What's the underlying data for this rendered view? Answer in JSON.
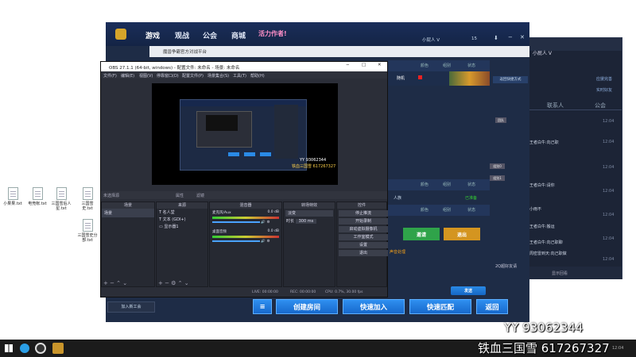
{
  "desktop": {
    "icons": [
      {
        "label": "小果果.txt"
      },
      {
        "label": "电竞帐.txt"
      },
      {
        "label": "三国雪后人星.txt"
      },
      {
        "label": "三国雪史.txt"
      },
      {
        "label": "三国雪史分部.txt"
      }
    ]
  },
  "client": {
    "nav": [
      "游戏",
      "观战",
      "公会",
      "商城"
    ],
    "banner": "活力作者!",
    "user": "小屁人 V",
    "coins": "15",
    "subwindow_title": "魔兽争霸官方对战平台",
    "table_headers": [
      "颜色",
      "组别",
      "状态"
    ],
    "row_name": "随机",
    "side_buttons": [
      "返回快捷方式",
      "团队"
    ],
    "mid_badges": [
      "组别0",
      "组别1"
    ],
    "player_label": "人族",
    "ready_label": "已准备",
    "btn_invite": "邀请",
    "btn_exit": "退出",
    "link_text": "声音处理",
    "add_friend": "加入新工会",
    "footer_hint": "2Q超好友请",
    "send_btn": "发送",
    "bottom_buttons": [
      "创建房间",
      "快速加入",
      "快速匹配",
      "返回"
    ]
  },
  "friends": {
    "title": "小屁人 V",
    "tabs": [
      "联系人",
      "公会"
    ],
    "rows": [
      "王者白牛:向己职",
      "王者白牛:请你",
      "小雨不",
      "王者白牛:搬运",
      "王者白牛:向己职聊",
      "周密雷到天:向己职做"
    ],
    "times": [
      "12:04",
      "12:04",
      "12:04",
      "12:04",
      "12:04",
      "12:04",
      "12:04"
    ],
    "footer": "显示回看",
    "side": [
      "应援完善",
      "实时好友"
    ]
  },
  "obs": {
    "title": "OBS 27.1.1 (64-bit, windows) - 配置文件: 未命名 - 场景: 未命名",
    "menu": [
      "文件(F)",
      "编辑(E)",
      "视图(V)",
      "停靠窗口(D)",
      "配置文件(P)",
      "场景集合(S)",
      "工具(T)",
      "帮助(H)"
    ],
    "source_bar": "未选择源",
    "props_btn": "属性",
    "filter_btn": "滤镜",
    "docks": {
      "scenes": "场景",
      "sources": "来源",
      "mixer": "混音器",
      "transitions": "转场特效",
      "controls": "控件"
    },
    "scene_item": "场景",
    "sources": [
      "名人堂",
      "文本 (GDI+)",
      "显示器1"
    ],
    "mixer_items": [
      {
        "name": "麦克风/Aux",
        "db": "0.0 dB"
      },
      {
        "name": "桌面音频",
        "db": "0.0 dB"
      }
    ],
    "transition": "淡变",
    "duration_label": "时长",
    "duration_value": "300 ms",
    "controls": [
      "停止推流",
      "开始录制",
      "启动虚拟摄像机",
      "工作室模式",
      "设置",
      "退出"
    ],
    "status": {
      "live": "LIVE: 00:00:00",
      "rec": "REC: 00:00:00",
      "cpu": "CPU: 0.7%, 30.00 fps"
    },
    "preview_yy": "YY 93062344",
    "preview_id": "铁血三国雪 617267327"
  },
  "overlay": {
    "yy": "YY 93062344",
    "name": "铁血三国雪 617267327"
  },
  "taskbar": {
    "time": "12:04"
  }
}
